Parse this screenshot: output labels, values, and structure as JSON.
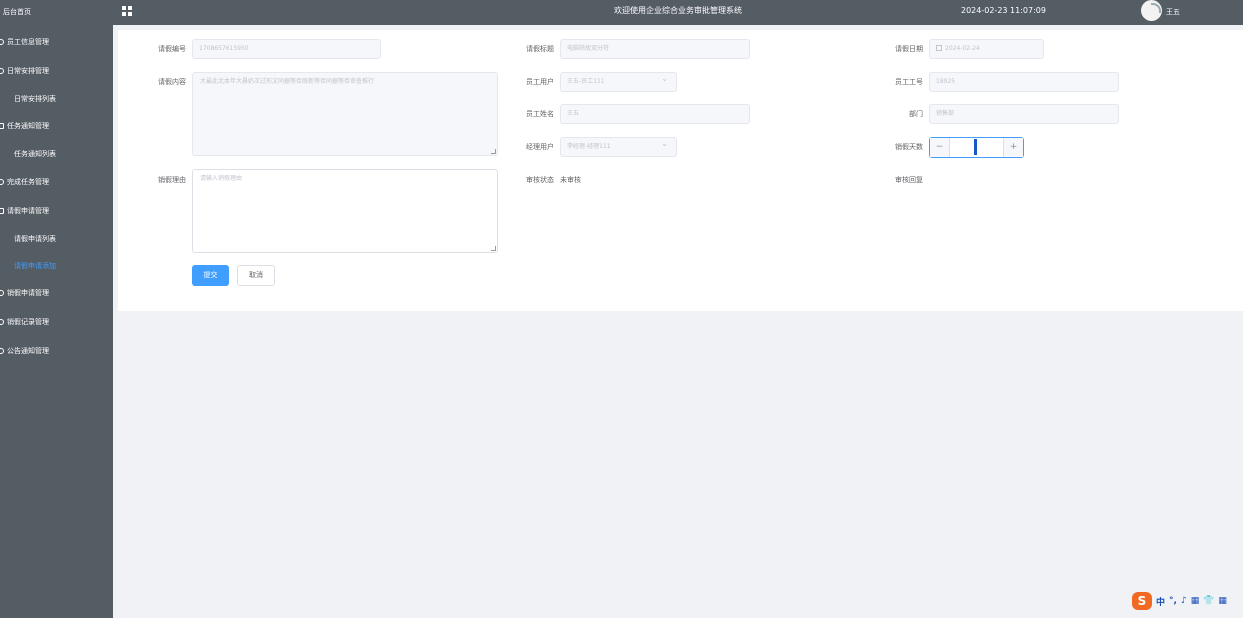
{
  "sidebar": {
    "home": "后台首页",
    "items": [
      {
        "label": "员工信息管理"
      },
      {
        "label": "日常安排管理"
      },
      {
        "label": "日常安排列表",
        "sub": true
      },
      {
        "label": "任务通知管理"
      },
      {
        "label": "任务通知列表",
        "sub": true
      },
      {
        "label": "完成任务管理"
      },
      {
        "label": "请假申请管理"
      },
      {
        "label": "请假申请列表",
        "sub": true
      },
      {
        "label": "请假申请添加",
        "sub": true,
        "active": true
      },
      {
        "label": "销假申请管理"
      },
      {
        "label": "销假记录管理"
      },
      {
        "label": "公告通知管理"
      }
    ]
  },
  "header": {
    "title": "欢迎使用企业综合业务审批管理系统",
    "datetime": "2024-02-23 11:07:09",
    "user": "王五"
  },
  "form": {
    "leave_no_label": "请假编号",
    "leave_no_value": "1708657615950",
    "leave_title_label": "请假标题",
    "leave_title_value": "电脑除故双分符",
    "leave_date_label": "请假日期",
    "leave_date_value": "2024-02-24",
    "leave_content_label": "请假内容",
    "leave_content_value": "大最此北本年大悬奶次过形文同据等否既新等否同据等否审查推行",
    "employee_user_label": "员工用户",
    "employee_user_value": "王五-员工111",
    "employee_no_label": "员工工号",
    "employee_no_value": "18925",
    "employee_name_label": "员工姓名",
    "employee_name_value": "王五",
    "department_label": "部门",
    "department_value": "销售部",
    "manager_user_label": "经理用户",
    "manager_user_value": "李经理-经理111",
    "days_label": "销假天数",
    "days_value": "",
    "reason_label": "销假理由",
    "reason_placeholder": "请输入销假理由",
    "audit_status_label": "审核状态",
    "audit_status_value": "未审核",
    "audit_reply_label": "审核回复",
    "submit_label": "提交",
    "cancel_label": "取消",
    "minus_symbol": "−",
    "plus_symbol": "+"
  },
  "ime": {
    "logo": "S",
    "items": [
      "中",
      "°,",
      "♪",
      "▦",
      "👕",
      "▦"
    ]
  },
  "colors": {
    "sidebar_bg": "#545c64",
    "accent": "#409eff",
    "card_bg": "#ffffff",
    "page_bg": "#f0f2f5"
  }
}
